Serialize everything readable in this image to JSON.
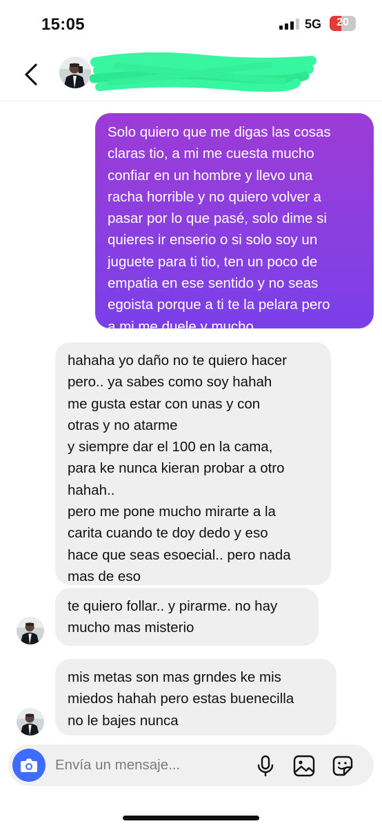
{
  "status_bar": {
    "time": "15:05",
    "network": "5G",
    "battery": "20",
    "battery_level_percent": 20,
    "signal_bars_active": 3,
    "signal_bars_total": 4
  },
  "header": {
    "back_icon": "chevron-left-icon",
    "avatar": "profile-avatar",
    "contact_name_redacted": true
  },
  "messages": [
    {
      "direction": "sent",
      "text": "Solo quiero que me digas las cosas\nclaras tio, a mi me cuesta mucho\nconfiar en un hombre y llevo una\nracha horrible y no quiero volver a\npasar por lo que pasé, solo dime si\nquieres ir enserio o si solo soy un\njuguete para ti tio, ten un poco de\nempatia en ese sentido y no seas\negoista porque a ti te la pelara pero\na mi me duele y mucho."
    },
    {
      "direction": "received",
      "text": "hahaha yo daño no te quiero hacer\npero.. ya sabes como soy hahah\nme gusta estar con unas y con\notras y no atarme\ny siempre dar el 100 en la cama,\npara ke nunca kieran probar a otro\nhahah..\npero me pone mucho mirarte a la\ncarita cuando te doy dedo y eso\nhace que seas esoecial.. pero nada\nmas de eso"
    },
    {
      "direction": "received",
      "text": "te quiero follar.. y pirarme. no hay\nmucho mas misterio"
    },
    {
      "direction": "received",
      "text": "mis metas son mas grndes ke mis\nmiedos hahah pero estas buenecilla\nno le bajes nunca"
    }
  ],
  "composer": {
    "placeholder": "Envía un mensaje...",
    "camera_icon": "camera-icon",
    "mic_icon": "microphone-icon",
    "gallery_icon": "image-gallery-icon",
    "sticker_icon": "sticker-icon"
  },
  "colors": {
    "sent_gradient_top": "#9c3bd6",
    "sent_gradient_bottom": "#7a3fe8",
    "received_bubble": "#efefef",
    "camera_button": "#3d6cff",
    "redaction_scribble": "#38f5a0",
    "battery_low": "#e53935"
  }
}
